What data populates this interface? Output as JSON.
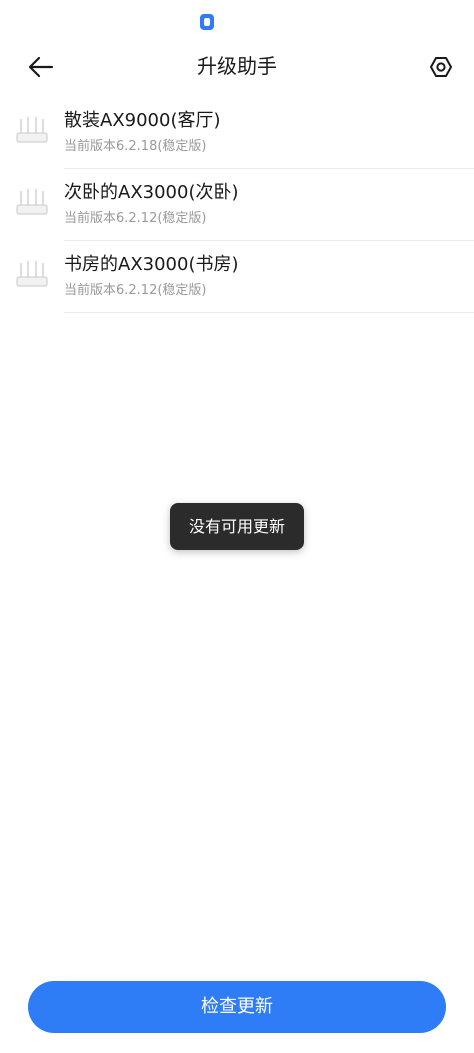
{
  "status_bar": {
    "indicator_icon": "notification-pill-icon",
    "indicator_color": "#2e7cf6"
  },
  "header": {
    "title": "升级助手",
    "back_icon": "arrow-left-icon",
    "settings_icon": "hexagon-settings-icon"
  },
  "routers": [
    {
      "name": "散装AX9000(客厅)",
      "version": "当前版本6.2.18(稳定版)",
      "icon": "router-icon"
    },
    {
      "name": "次卧的AX3000(次卧)",
      "version": "当前版本6.2.12(稳定版)",
      "icon": "router-icon"
    },
    {
      "name": "书房的AX3000(书房)",
      "version": "当前版本6.2.12(稳定版)",
      "icon": "router-icon"
    }
  ],
  "toast": {
    "message": "没有可用更新"
  },
  "footer": {
    "check_update_label": "检查更新"
  },
  "colors": {
    "accent": "#2f7df6",
    "title_text": "#1a1a1a",
    "secondary_text": "#999999",
    "toast_bg": "#2b2b2b"
  }
}
